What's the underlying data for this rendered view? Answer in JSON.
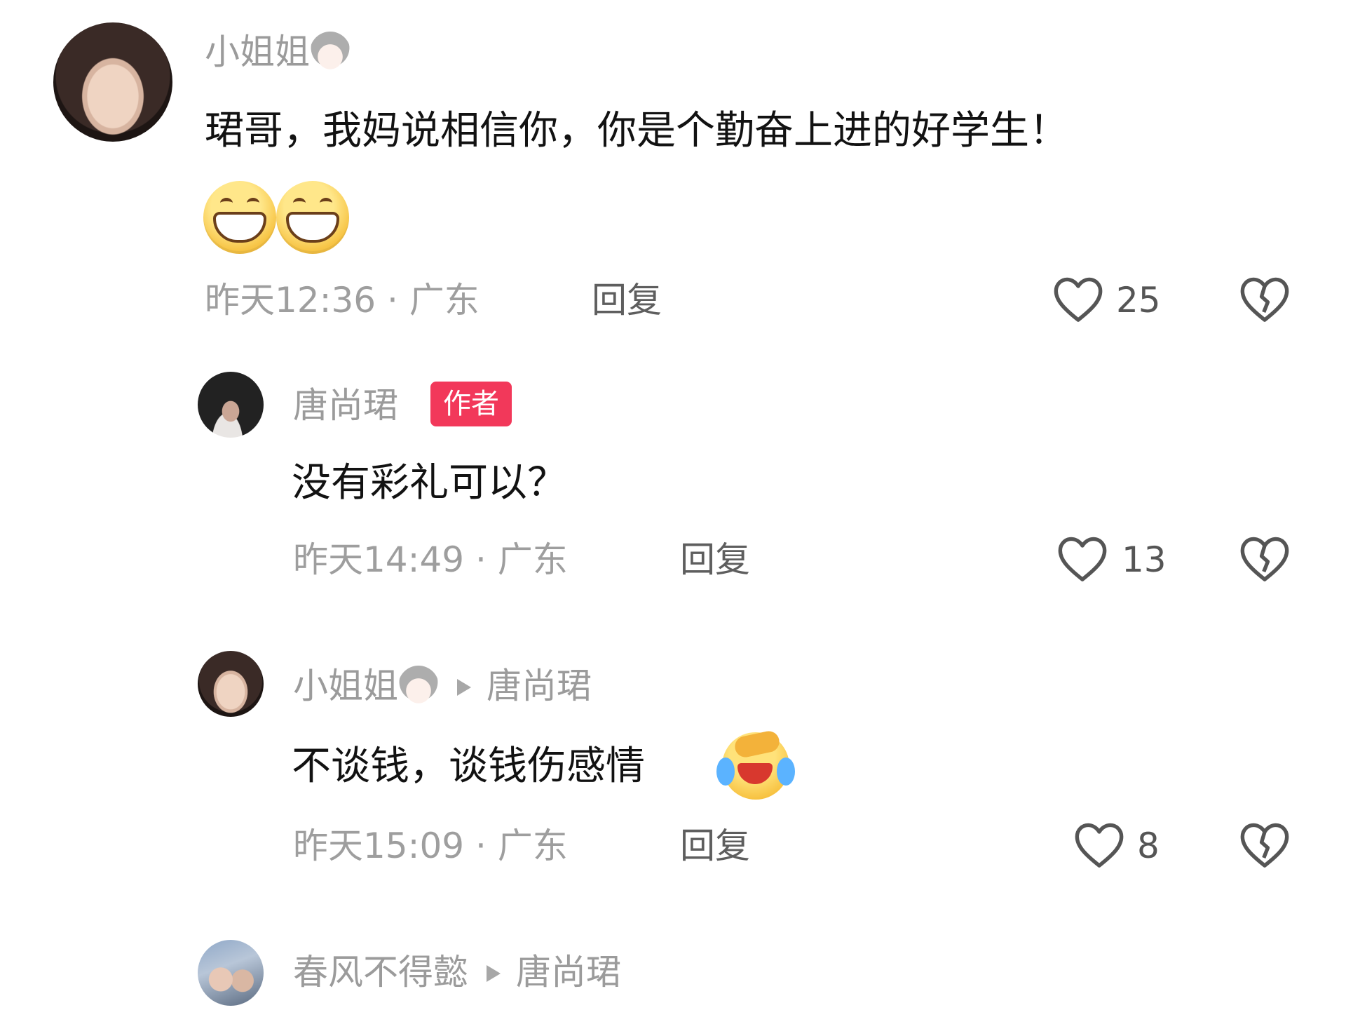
{
  "comments": [
    {
      "author": "小姐姐",
      "text": "珺哥，我妈说相信你，你是个勤奋上进的好学生！",
      "time_location": "昨天12:36 · 广东",
      "reply_label": "回复",
      "likes": "25"
    },
    {
      "author": "唐尚珺",
      "badge": "作者",
      "text": "没有彩礼可以？",
      "time_location": "昨天14:49 · 广东",
      "reply_label": "回复",
      "likes": "13"
    },
    {
      "author": "小姐姐",
      "reply_to": "唐尚珺",
      "text": "不谈钱，谈钱伤感情",
      "time_location": "昨天15:09 · 广东",
      "reply_label": "回复",
      "likes": "8"
    },
    {
      "author": "春风不得懿",
      "reply_to": "唐尚珺"
    }
  ],
  "icons": {
    "like": "heart-outline-icon",
    "dislike": "broken-heart-icon",
    "reply_arrow": "triangle-right-icon"
  },
  "colors": {
    "author_badge": "#f2385a",
    "name_gray": "#9b9b9b",
    "text": "#121212"
  }
}
